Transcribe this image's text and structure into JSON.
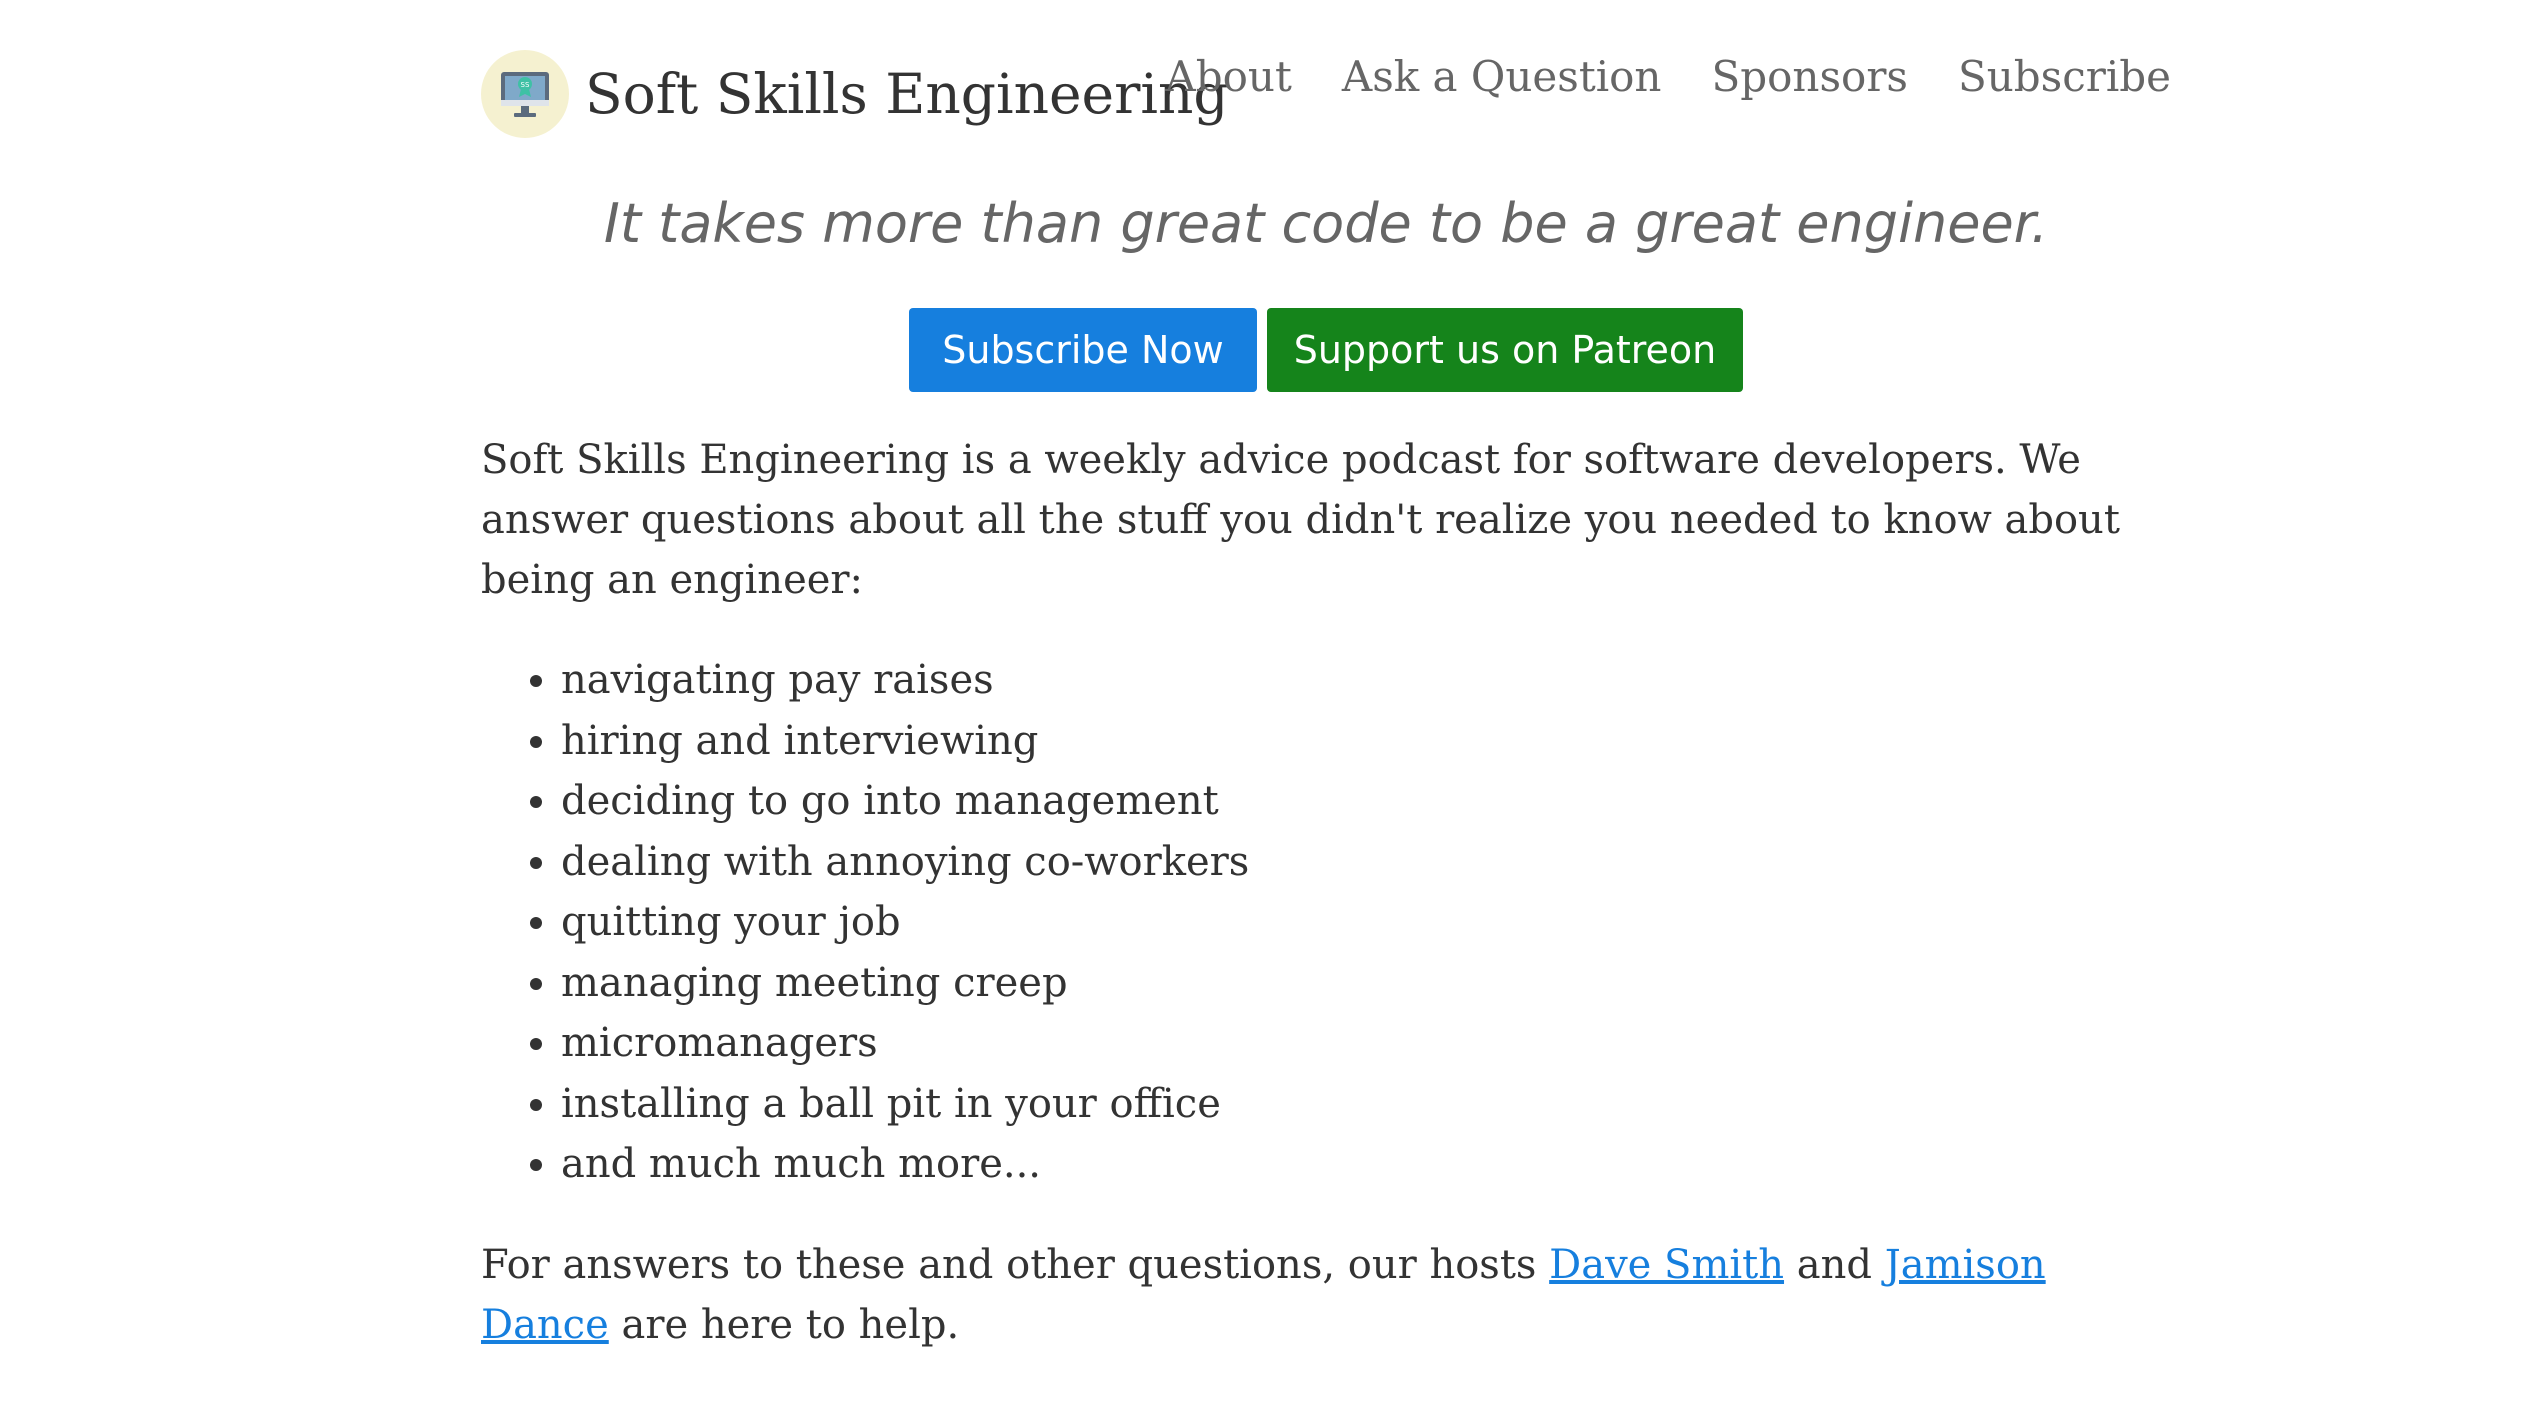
{
  "header": {
    "site_title": "Soft Skills Engineering",
    "logo_icon": "computer-monitor-icon",
    "nav": [
      {
        "label": "About"
      },
      {
        "label": "Ask a Question"
      },
      {
        "label": "Sponsors"
      },
      {
        "label": "Subscribe"
      }
    ]
  },
  "hero": {
    "tagline": "It takes more than great code to be a great engineer.",
    "subscribe_button": "Subscribe Now",
    "patreon_button": "Support us on Patreon"
  },
  "main": {
    "intro": "Soft Skills Engineering is a weekly advice podcast for software developers. We answer questions about all the stuff you didn't realize you needed to know about being an engineer:",
    "topics": [
      "navigating pay raises",
      "hiring and interviewing",
      "deciding to go into management",
      "dealing with annoying co-workers",
      "quitting your job",
      "managing meeting creep",
      "micromanagers",
      "installing a ball pit in your office",
      "and much much more..."
    ],
    "outro_before": "For answers to these and other questions, our hosts ",
    "host1": "Dave Smith",
    "outro_middle": " and ",
    "host2": "Jamison Dance",
    "outro_after": " are here to help."
  },
  "colors": {
    "link": "#167fde",
    "subscribe_button_bg": "#167fde",
    "patreon_button_bg": "#15841b",
    "logo_bg": "#f5f1d0"
  }
}
